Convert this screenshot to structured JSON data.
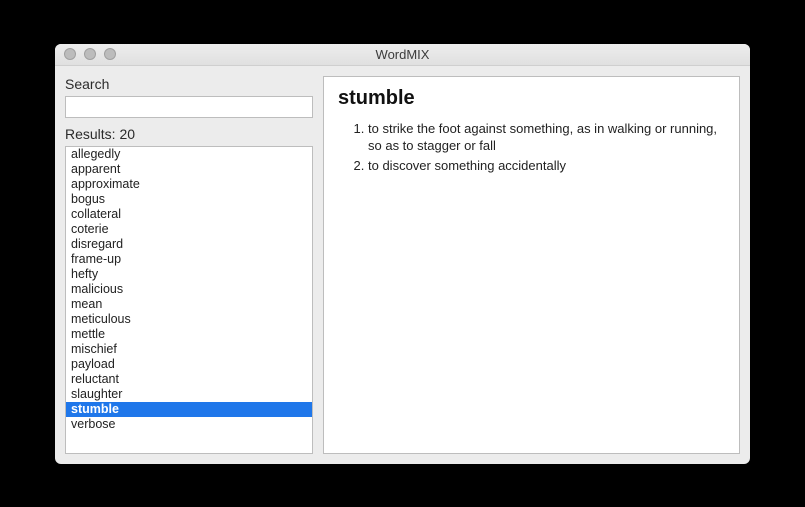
{
  "window": {
    "title": "WordMIX"
  },
  "left": {
    "search_label": "Search",
    "search_value": "",
    "results_label": "Results: 20",
    "items": [
      "allegedly",
      "apparent",
      "approximate",
      "bogus",
      "collateral",
      "coterie",
      "disregard",
      "frame-up",
      "hefty",
      "malicious",
      "mean",
      "meticulous",
      "mettle",
      "mischief",
      "payload",
      "reluctant",
      "slaughter",
      "stumble",
      "verbose"
    ],
    "selected_index": 17
  },
  "detail": {
    "word": "stumble",
    "definitions": [
      "to strike the foot against something, as in walking or running, so as to stagger or fall",
      "to discover something accidentally"
    ]
  }
}
